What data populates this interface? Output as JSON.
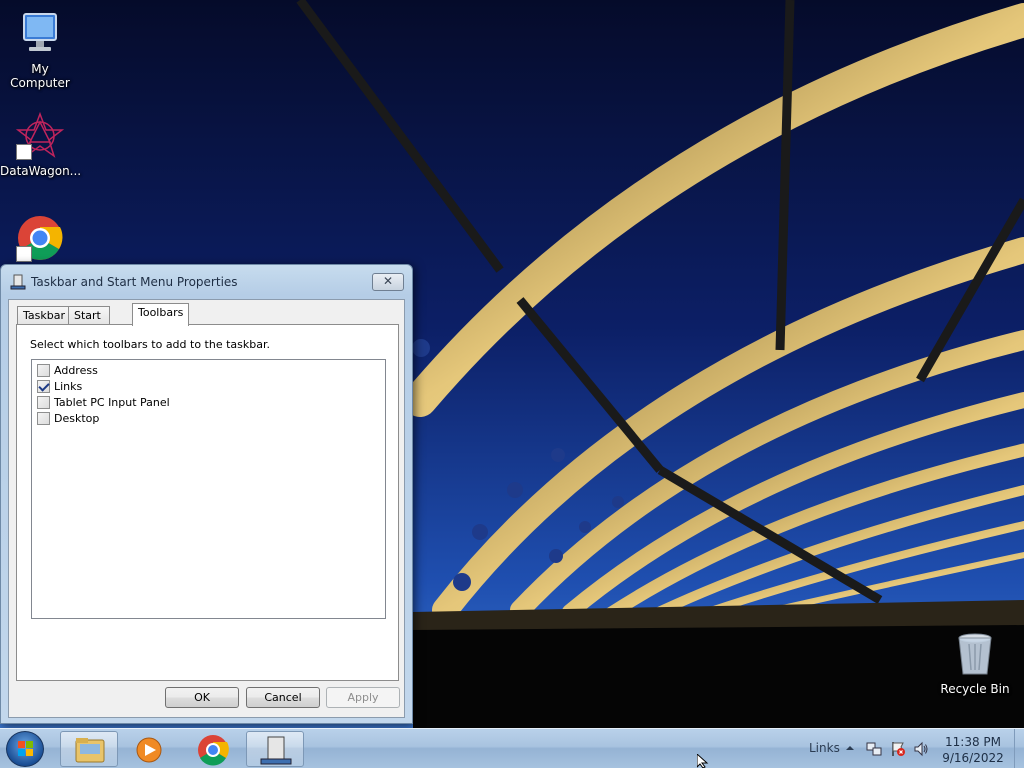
{
  "desktop": {
    "icons": [
      {
        "label": "My Computer"
      },
      {
        "label": "DataWagon..."
      },
      {
        "label": ""
      },
      {
        "label": "Recycle Bin"
      }
    ]
  },
  "dialog": {
    "title": "Taskbar and Start Menu Properties",
    "close_label": "✕",
    "tabs": [
      {
        "label": "Taskbar",
        "active": false
      },
      {
        "label": "Start Menu",
        "active": false
      },
      {
        "label": "Toolbars",
        "active": true
      }
    ],
    "instruction": "Select which toolbars to add to the taskbar.",
    "toolbars": [
      {
        "label": "Address",
        "checked": false
      },
      {
        "label": "Links",
        "checked": true
      },
      {
        "label": "Tablet PC Input Panel",
        "checked": false
      },
      {
        "label": "Desktop",
        "checked": false
      }
    ],
    "buttons": {
      "ok": "OK",
      "cancel": "Cancel",
      "apply": "Apply"
    }
  },
  "taskbar": {
    "apps": [
      {
        "icon": "folder-icon",
        "running": true
      },
      {
        "icon": "media-player-icon",
        "running": false
      },
      {
        "icon": "chrome-icon",
        "running": false
      },
      {
        "icon": "taskbar-properties-icon",
        "running": true
      }
    ],
    "tray": {
      "links_toolbar": "Links",
      "expand_icon": "chevron-up-icon",
      "icons": [
        "network-icon",
        "action-center-flag-icon",
        "volume-icon"
      ]
    },
    "clock": {
      "time": "11:38 PM",
      "date": "9/16/2022"
    }
  }
}
